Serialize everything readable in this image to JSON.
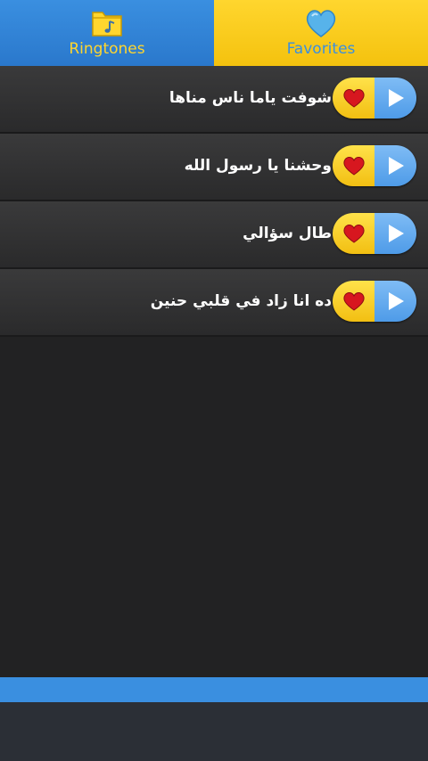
{
  "tabs": [
    {
      "label": "Ringtones",
      "icon": "music-folder-icon",
      "color": "#3a8fe0"
    },
    {
      "label": "Favorites",
      "icon": "heart-icon",
      "color": "#ffd62e"
    }
  ],
  "ringtones": [
    {
      "title": "شوفت ياما ناس مناها"
    },
    {
      "title": "وحشنا يا رسول الله"
    },
    {
      "title": "طال سؤالي"
    },
    {
      "title": "ده انا زاد في قلبي حنين"
    }
  ]
}
